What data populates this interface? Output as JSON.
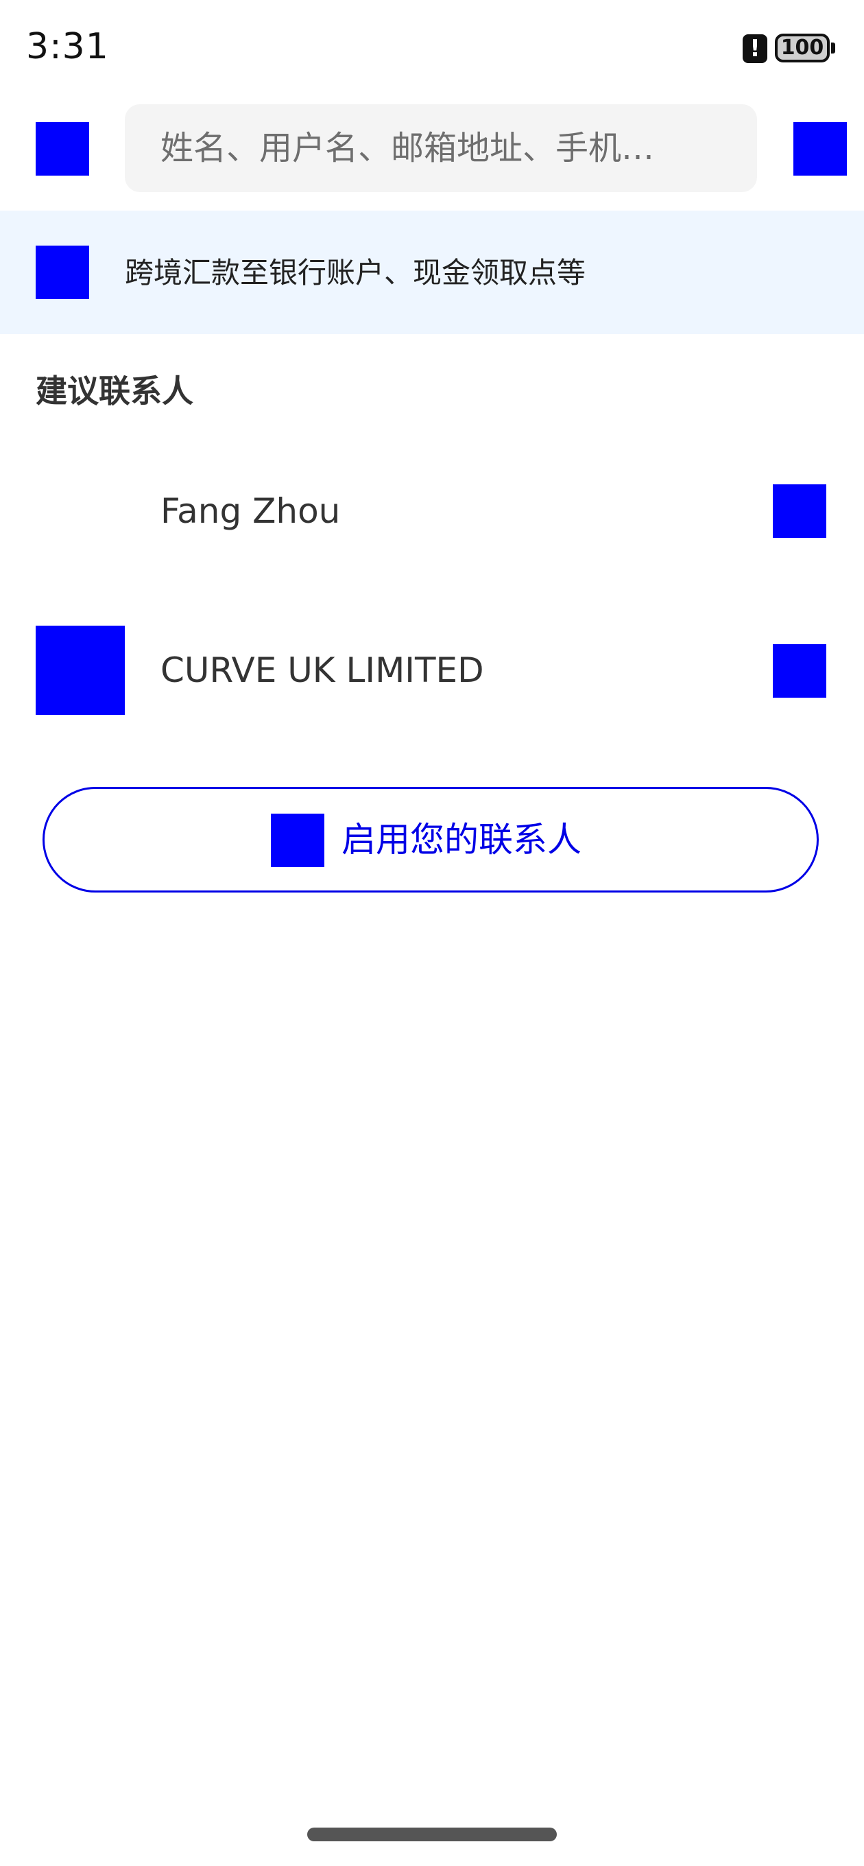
{
  "status_bar": {
    "time": "3:31",
    "alert_glyph": "!",
    "battery_level": "100"
  },
  "search": {
    "placeholder": "姓名、用户名、邮箱地址、手机…"
  },
  "banner": {
    "text": "跨境汇款至银行账户、现金领取点等"
  },
  "suggested": {
    "title": "建议联系人",
    "contacts": [
      {
        "name": "Fang Zhou",
        "has_avatar": false
      },
      {
        "name": "CURVE UK LIMITED",
        "has_avatar": true
      }
    ]
  },
  "enable_contacts": {
    "label": "启用您的联系人"
  },
  "colors": {
    "accent": "#0000e6",
    "placeholder_icon": "#0000ff",
    "banner_bg": "#eef6ff",
    "search_bg": "#f4f4f4"
  },
  "icons": {
    "back": "back-arrow-icon",
    "scan": "qr-scan-icon",
    "banner": "globe-transfer-icon",
    "row_action": "chevron-right-icon",
    "enable": "contacts-icon"
  }
}
